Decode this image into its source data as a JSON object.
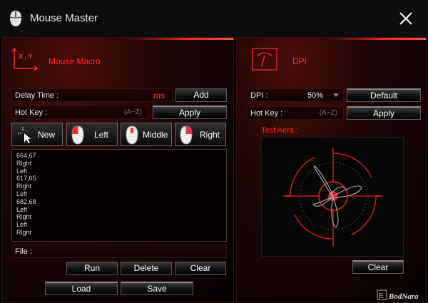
{
  "window": {
    "title": "Mouse Master"
  },
  "macro": {
    "section_title": "Mouse Macro",
    "axis_icon_label": "X , Y",
    "delay_label": "Delay Time :",
    "delay_unit": "ms",
    "add_label": "Add",
    "hotkey_label": "Hot Key :",
    "hotkey_hint": "(A~Z)",
    "apply_label": "Apply",
    "buttons": {
      "new": "New",
      "left": "Left",
      "middle": "Middle",
      "right": "Right"
    },
    "events": [
      "664,67",
      "Right",
      "Left",
      "617,65",
      "Right",
      "Left",
      "682,68",
      "Left",
      "Right",
      "Left",
      "Right"
    ],
    "file_label": "File :",
    "run_label": "Run",
    "delete_label": "Delete",
    "clear_label": "Clear",
    "load_label": "Load",
    "save_label": "Save"
  },
  "dpi": {
    "section_title": "DPI",
    "dpi_label": "DPI :",
    "dpi_value": "50%",
    "default_label": "Default",
    "hotkey_label": "Hot Key :",
    "hotkey_hint": "(A~Z)",
    "apply_label": "Apply",
    "test_area_label": "Test Aera :",
    "clear_label": "Clear"
  },
  "watermark": {
    "text": "BodNara"
  },
  "colors": {
    "accent": "#ff2a2a",
    "panel_bg": "#1a0505",
    "button_border": "#5a5a5a"
  },
  "icons": {
    "title": "mouse-icon",
    "close": "close-icon",
    "macro": "xy-axis-icon",
    "dpi": "gauge-icon",
    "new": "crosshair-cursor-icon",
    "left": "left-click-mouse-icon",
    "middle": "middle-click-mouse-icon",
    "right": "right-click-mouse-icon",
    "dropdown": "dropdown-arrow-icon"
  }
}
